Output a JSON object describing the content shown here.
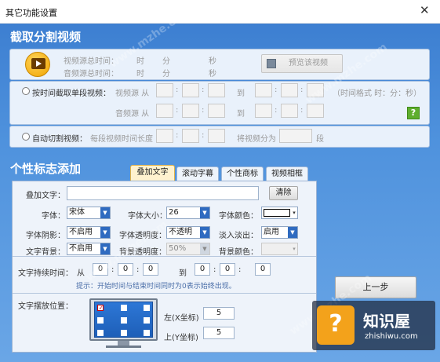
{
  "window": {
    "title": "其它功能设置",
    "close_glyph": "✕"
  },
  "section1": {
    "title": "截取分割视频"
  },
  "info": {
    "video_total_label": "视频源总时间：",
    "audio_total_label": "音频源总时间：",
    "hour": "时",
    "minute": "分",
    "second": "秒",
    "preview_button": "预览该视频"
  },
  "by_time": {
    "label": "按时间截取单段视频：",
    "video_src": "视频源 从",
    "audio_src": "音频源 从",
    "to": "到",
    "format_hint": "（时间格式 时：分：秒）",
    "colon": ":"
  },
  "auto_split": {
    "label": "自动切割视频：",
    "segment_length": "每段视频时间长度",
    "split_into": "将视频分为",
    "unit": "段"
  },
  "section2": {
    "title": "个性标志添加"
  },
  "tabs": [
    "叠加文字",
    "滚动字幕",
    "个性商标",
    "视频相框"
  ],
  "overlay": {
    "text_label": "叠加文字：",
    "text_value": "",
    "clear_button": "清除",
    "font_label": "字体：",
    "font_value": "宋体",
    "size_label": "字体大小：",
    "size_value": "26",
    "color_label": "字体颜色：",
    "shadow_label": "字体阴影：",
    "shadow_value": "不启用",
    "opacity_label": "字体透明度：",
    "opacity_value": "不透明",
    "fade_label": "淡入淡出：",
    "fade_value": "启用",
    "bg_label": "文字背景：",
    "bg_value": "不启用",
    "bg_opacity_label": "背景透明度：",
    "bg_opacity_value": "50%",
    "bg_color_label": "背景颜色：",
    "duration_label": "文字持续时间：",
    "from": "从",
    "to": "到",
    "dur_start": [
      "0",
      "0",
      "0"
    ],
    "dur_end": [
      "0",
      "0",
      "0"
    ],
    "hint": "提示：开始时间与结束时间同时为0表示始终出现。",
    "position_label": "文字摆放位置：",
    "left_label": "左(X坐标)",
    "left_value": "5",
    "top_label": "上(Y坐标)",
    "top_value": "5"
  },
  "prev_button": "上一步",
  "watermarks": [
    "www.mzhe.com",
    "www.mzhe.com",
    "www.mzhe.com",
    "www.mzhe.com"
  ],
  "badge": {
    "title": "知识屋",
    "url": "zhishiwu.com",
    "icon_glyph": "?"
  },
  "help_glyph": "?"
}
